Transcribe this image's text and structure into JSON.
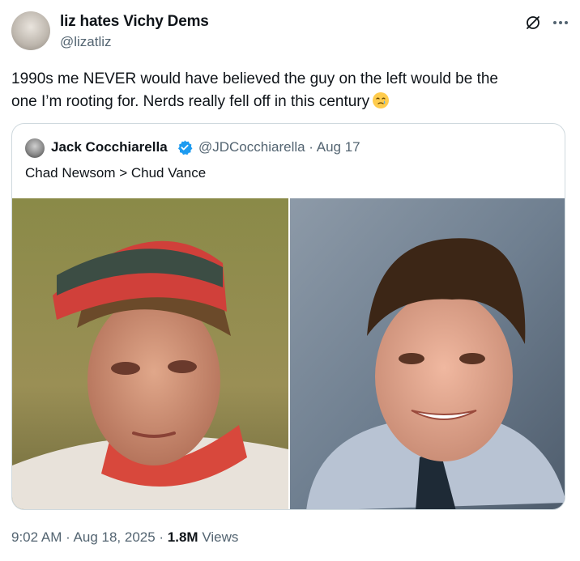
{
  "author": {
    "display_name": "liz hates Vichy Dems",
    "handle": "@lizatliz"
  },
  "tweet": {
    "line1": "1990s me NEVER would have believed the guy on the left would be the",
    "line2": "one I’m rooting for. Nerds really fell off in this century",
    "emoji": "face-holding-back-tears"
  },
  "quoted": {
    "display_name": "Jack Cocchiarella",
    "handle_date": "@JDCocchiarella · Aug 17",
    "text": "Chad Newsom > Chud Vance",
    "verified": true
  },
  "meta": {
    "time_date": "9:02 AM · Aug 18, 2025 · ",
    "views_count": "1.8M",
    "views_label": " Views"
  },
  "icons": {
    "grok": "grok-icon",
    "more": "more-icon"
  },
  "colors": {
    "secondary_text": "#536471",
    "verified_blue": "#1d9bf0",
    "border": "#cfd9de"
  }
}
